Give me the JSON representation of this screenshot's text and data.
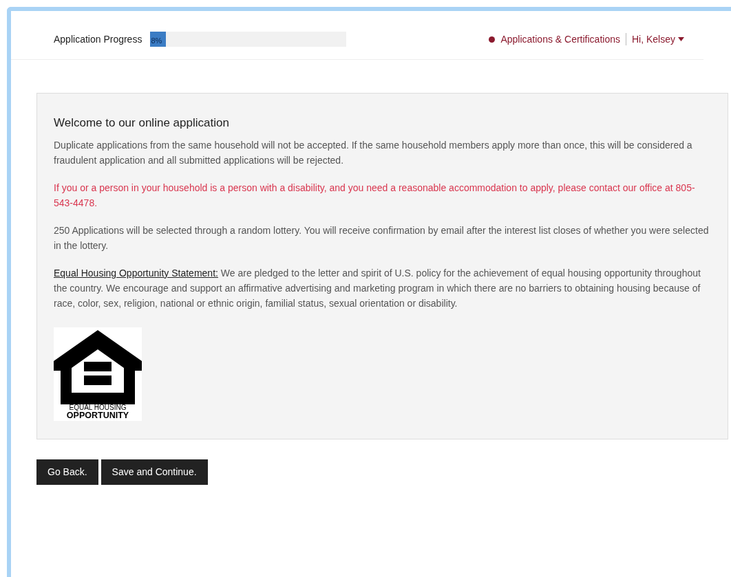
{
  "header": {
    "progress": {
      "label": "Application Progress",
      "level": 0.08,
      "reading": "8%"
    },
    "nav": {
      "link": "Applications & Certifications",
      "user": "Hi, Kelsey"
    }
  },
  "panel": {
    "title": "Welcome to our online application",
    "paragraphs": [
      {
        "kind": "plain",
        "text": "Duplicate applications from the same household will not be accepted. If the same household members apply more than once, this will be considered a fraudulent application and all submitted applications will be rejected."
      },
      {
        "kind": "alert",
        "text": "If you or a person in your household is a person with a disability, and you need a reasonable accommodation to apply, please contact our office at 805-543-4478."
      },
      {
        "kind": "plain",
        "text": "250 Applications will be selected through a random lottery. You will receive confirmation by email after the interest list closes of whether you were selected in the lottery."
      },
      {
        "kind": "statement",
        "lead": "Equal Housing Opportunity Statement:",
        "text": "We are pledged to the letter and spirit of U.S. policy for the achievement of equal housing opportunity throughout the country. We encourage and support an affirmative advertising and marketing program in which there are no barriers to obtaining housing because of race, color, sex, religion, national or ethnic origin, familial status, sexual orientation or disability."
      }
    ],
    "logo": {
      "line_1": "EQUAL HOUSING",
      "line_2": "OPPORTUNITY"
    }
  },
  "buttons": [
    "Go Back.",
    "Save and Continue."
  ]
}
